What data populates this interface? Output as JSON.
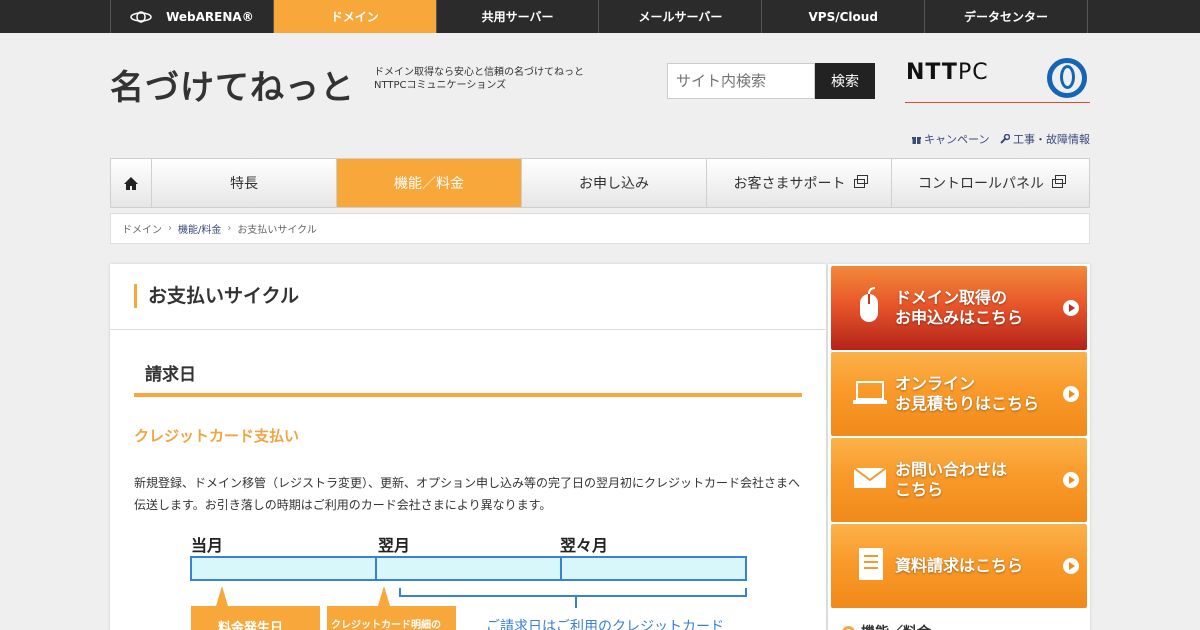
{
  "topnav": {
    "items": [
      {
        "label": "WebARENA®"
      },
      {
        "label": "ドメイン"
      },
      {
        "label": "共用サーバー"
      },
      {
        "label": "メールサーバー"
      },
      {
        "label": "VPS/Cloud"
      },
      {
        "label": "データセンター"
      }
    ],
    "active_index": 1
  },
  "header": {
    "site_title": "名づけてねっと",
    "tagline_line1": "ドメイン取得なら安心と信頼の名づけてねっと",
    "tagline_line2": "NTTPCコミュニケーションズ",
    "search_placeholder": "サイト内検索",
    "search_button": "検索",
    "ntt_text": "NTT",
    "ntt_pc": "PC"
  },
  "util_links": {
    "campaign": "キャンペーン",
    "maintenance": "工事・故障情報"
  },
  "gnav": {
    "items": [
      "特長",
      "機能／料金",
      "お申し込み",
      "お客さまサポート",
      "コントロールパネル"
    ],
    "active_index": 1
  },
  "breadcrumb": {
    "items": [
      "ドメイン",
      "機能/料金",
      "お支払いサイクル"
    ]
  },
  "main": {
    "page_title": "お支払いサイクル",
    "h2": "請求日",
    "h3": "クレジットカード支払い",
    "body_text": "新規登録、ドメイン移管（レジストラ変更）、更新、オプション申し込み等の完了日の翌月初にクレジットカード会社さまへ伝送します。お引き落しの時期はご利用のカード会社さまにより異なります。"
  },
  "diagram": {
    "months": [
      "当月",
      "翌月",
      "翌々月"
    ],
    "label_fee": "料金発生日",
    "label_card": "クレジットカード明細の",
    "label_billing": "ご請求日はご利用のクレジットカード"
  },
  "sidebar": {
    "banners": [
      {
        "line1": "ドメイン取得の",
        "line2": "お申込みはこちら"
      },
      {
        "line1": "オンライン",
        "line2": "お見積もりはこちら"
      },
      {
        "line1": "お問い合わせは",
        "line2": "こちら"
      },
      {
        "line1": "資料請求はこちら",
        "line2": ""
      }
    ],
    "heading": "機能／料金"
  },
  "colors": {
    "accent": "#f8a73a",
    "topbar": "#2b2b2b",
    "diagram_blue": "#3a7fd8",
    "banner_red": "#c42e1e"
  }
}
